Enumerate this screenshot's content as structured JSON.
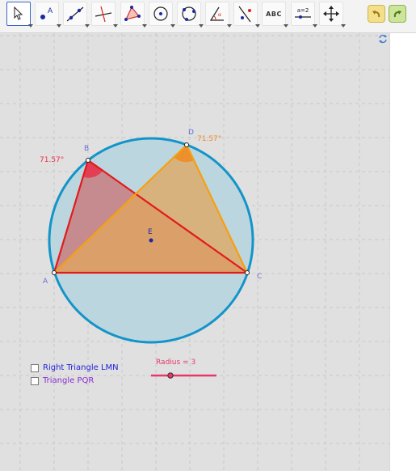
{
  "toolbar": {
    "text_tool_label": "ABC",
    "slider_tool_label": "a=2"
  },
  "points": {
    "A": "A",
    "B": "B",
    "C": "C",
    "D": "D",
    "E": "E"
  },
  "angles": {
    "B_label": "71.57°",
    "D_label": "71.57°"
  },
  "checkboxes": {
    "lmn_label": "Right Triangle LMN",
    "pqr_label": "Triangle PQR",
    "lmn_checked": false,
    "pqr_checked": false
  },
  "slider": {
    "label": "Radius = 3",
    "value": 3
  },
  "colors": {
    "circle_stroke": "#1394c8",
    "circle_fill": "#bfd8e0",
    "triangle_abc": "#e21b1b",
    "triangle_adc": "#f5a011",
    "angle_b": "#e8304a",
    "angle_d": "#f08a1e",
    "slider": "#e8376b",
    "lmn_text": "#2222dd",
    "pqr_text": "#8a2bd0"
  }
}
